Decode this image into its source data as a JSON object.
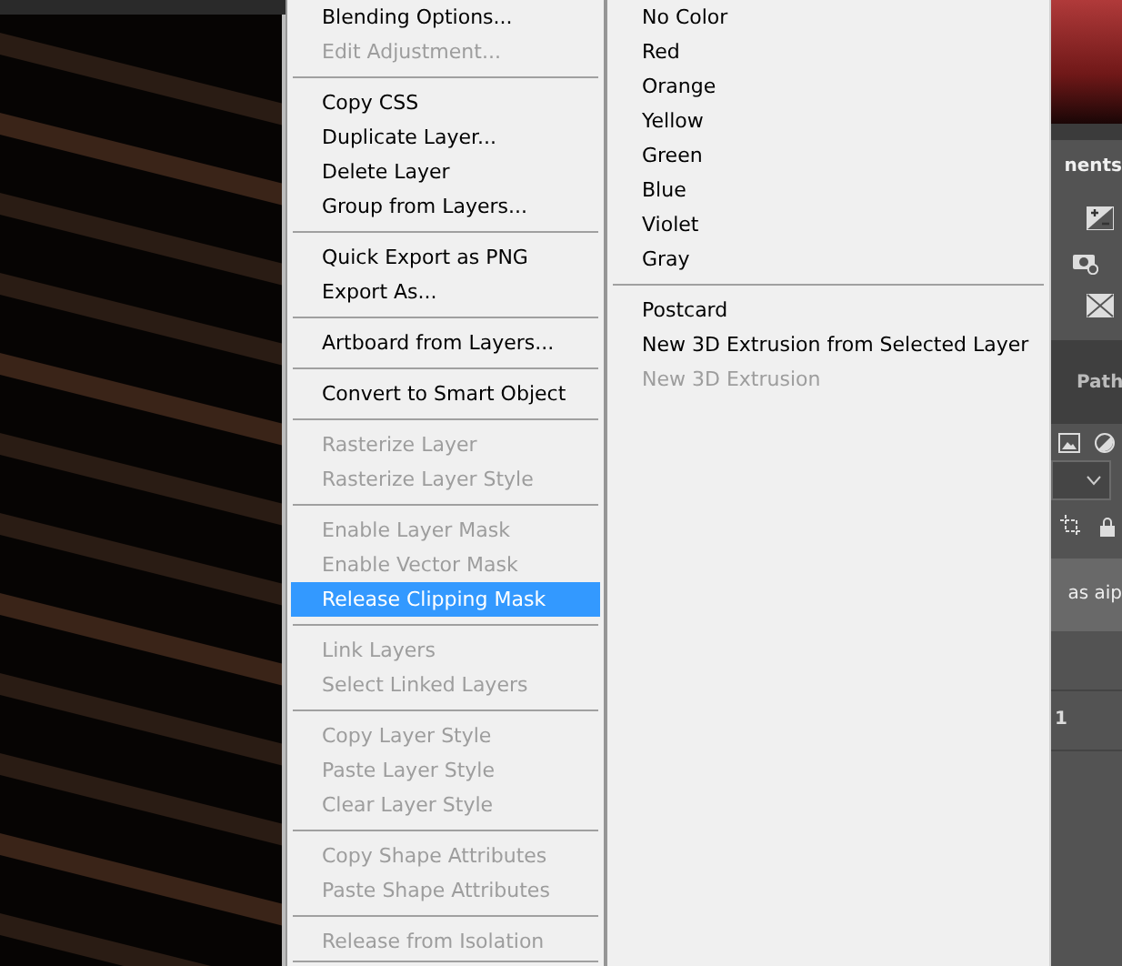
{
  "context_menu": {
    "sections": [
      [
        {
          "label": "Blending Options...",
          "disabled": false,
          "selected": false
        },
        {
          "label": "Edit Adjustment...",
          "disabled": true,
          "selected": false
        }
      ],
      [
        {
          "label": "Copy CSS",
          "disabled": false,
          "selected": false
        },
        {
          "label": "Duplicate Layer...",
          "disabled": false,
          "selected": false
        },
        {
          "label": "Delete Layer",
          "disabled": false,
          "selected": false
        },
        {
          "label": "Group from Layers...",
          "disabled": false,
          "selected": false
        }
      ],
      [
        {
          "label": "Quick Export as PNG",
          "disabled": false,
          "selected": false
        },
        {
          "label": "Export As...",
          "disabled": false,
          "selected": false
        }
      ],
      [
        {
          "label": "Artboard from Layers...",
          "disabled": false,
          "selected": false
        }
      ],
      [
        {
          "label": "Convert to Smart Object",
          "disabled": false,
          "selected": false
        }
      ],
      [
        {
          "label": "Rasterize Layer",
          "disabled": true,
          "selected": false
        },
        {
          "label": "Rasterize Layer Style",
          "disabled": true,
          "selected": false
        }
      ],
      [
        {
          "label": "Enable Layer Mask",
          "disabled": true,
          "selected": false
        },
        {
          "label": "Enable Vector Mask",
          "disabled": true,
          "selected": false
        },
        {
          "label": "Release Clipping Mask",
          "disabled": false,
          "selected": true
        }
      ],
      [
        {
          "label": "Link Layers",
          "disabled": true,
          "selected": false
        },
        {
          "label": "Select Linked Layers",
          "disabled": true,
          "selected": false
        }
      ],
      [
        {
          "label": "Copy Layer Style",
          "disabled": true,
          "selected": false
        },
        {
          "label": "Paste Layer Style",
          "disabled": true,
          "selected": false
        },
        {
          "label": "Clear Layer Style",
          "disabled": true,
          "selected": false
        }
      ],
      [
        {
          "label": "Copy Shape Attributes",
          "disabled": true,
          "selected": false
        },
        {
          "label": "Paste Shape Attributes",
          "disabled": true,
          "selected": false
        }
      ],
      [
        {
          "label": "Release from Isolation",
          "disabled": true,
          "selected": false
        }
      ]
    ],
    "ends_with_separator": true
  },
  "submenu": {
    "sections": [
      [
        {
          "label": "No Color",
          "disabled": false,
          "selected": false
        },
        {
          "label": "Red",
          "disabled": false,
          "selected": false
        },
        {
          "label": "Orange",
          "disabled": false,
          "selected": false
        },
        {
          "label": "Yellow",
          "disabled": false,
          "selected": false
        },
        {
          "label": "Green",
          "disabled": false,
          "selected": false
        },
        {
          "label": "Blue",
          "disabled": false,
          "selected": false
        },
        {
          "label": "Violet",
          "disabled": false,
          "selected": false
        },
        {
          "label": "Gray",
          "disabled": false,
          "selected": false
        }
      ],
      [
        {
          "label": "Postcard",
          "disabled": false,
          "selected": false
        },
        {
          "label": "New 3D Extrusion from Selected Layer",
          "disabled": false,
          "selected": false
        },
        {
          "label": "New 3D Extrusion",
          "disabled": true,
          "selected": false
        }
      ]
    ]
  },
  "panel": {
    "adjustments_tab": "nents",
    "paths_tab": "Path",
    "layer_name": "as aip",
    "layer_label": "1"
  }
}
